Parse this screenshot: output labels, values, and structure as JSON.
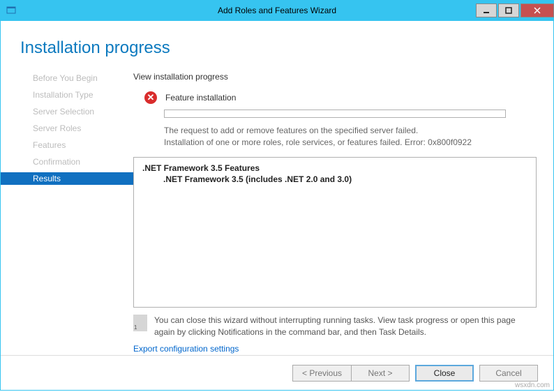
{
  "titlebar": {
    "title": "Add Roles and Features Wizard"
  },
  "header": {
    "page_title": "Installation progress"
  },
  "sidebar": {
    "items": [
      {
        "label": "Before You Begin",
        "selected": false
      },
      {
        "label": "Installation Type",
        "selected": false
      },
      {
        "label": "Server Selection",
        "selected": false
      },
      {
        "label": "Server Roles",
        "selected": false
      },
      {
        "label": "Features",
        "selected": false
      },
      {
        "label": "Confirmation",
        "selected": false
      },
      {
        "label": "Results",
        "selected": true
      }
    ]
  },
  "main": {
    "instruction": "View installation progress",
    "status_label": "Feature installation",
    "message_line1": "The request to add or remove features on the specified server failed.",
    "message_line2": "Installation of one or more roles, role services, or features failed. Error: 0x800f0922",
    "features": {
      "parent": ".NET Framework 3.5 Features",
      "child": ".NET Framework 3.5 (includes .NET 2.0 and 3.0)"
    },
    "note": "You can close this wizard without interrupting running tasks. View task progress or open this page again by clicking Notifications in the command bar, and then Task Details.",
    "export_link": "Export configuration settings"
  },
  "buttons": {
    "previous": "< Previous",
    "next": "Next >",
    "close": "Close",
    "cancel": "Cancel"
  },
  "watermark": "wsxdn.com"
}
